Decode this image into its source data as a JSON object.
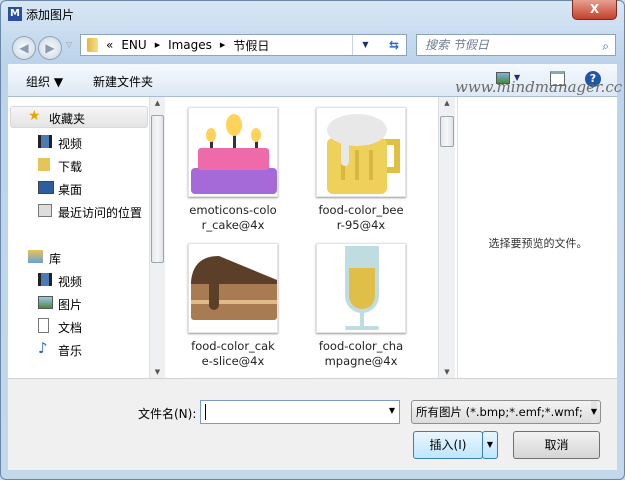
{
  "window": {
    "title": "添加图片",
    "close": "X"
  },
  "address": {
    "prefix": "«",
    "crumbs": [
      "ENU",
      "Images",
      "节假日"
    ],
    "separator": "▶"
  },
  "search": {
    "placeholder": "搜索 节假日"
  },
  "toolbar": {
    "organize": "组织 ▼",
    "new_folder": "新建文件夹",
    "watermark": "www.mindmanager.cc"
  },
  "sidebar": {
    "favorites": {
      "label": "收藏夹",
      "items": [
        {
          "label": "视频",
          "icon": "video-icon"
        },
        {
          "label": "下载",
          "icon": "folder-icon"
        },
        {
          "label": "桌面",
          "icon": "desktop-icon"
        },
        {
          "label": "最近访问的位置",
          "icon": "recent-icon"
        }
      ]
    },
    "libraries": {
      "label": "库",
      "items": [
        {
          "label": "视频",
          "icon": "video-icon"
        },
        {
          "label": "图片",
          "icon": "picture-icon"
        },
        {
          "label": "文档",
          "icon": "document-icon"
        },
        {
          "label": "音乐",
          "icon": "music-icon"
        }
      ]
    }
  },
  "files": [
    {
      "line1": "emoticons-colo",
      "line2": "r_cake@4x"
    },
    {
      "line1": "food-color_bee",
      "line2": "r-95@4x"
    },
    {
      "line1": "food-color_cak",
      "line2": "e-slice@4x"
    },
    {
      "line1": "food-color_cha",
      "line2": "mpagne@4x"
    }
  ],
  "preview": {
    "text": "选择要预览的文件。"
  },
  "bottom": {
    "filename_label": "文件名(N):",
    "filename_value": "",
    "filetype": "所有图片 (*.bmp;*.emf;*.wmf;",
    "insert": "插入(I)",
    "cancel": "取消"
  }
}
